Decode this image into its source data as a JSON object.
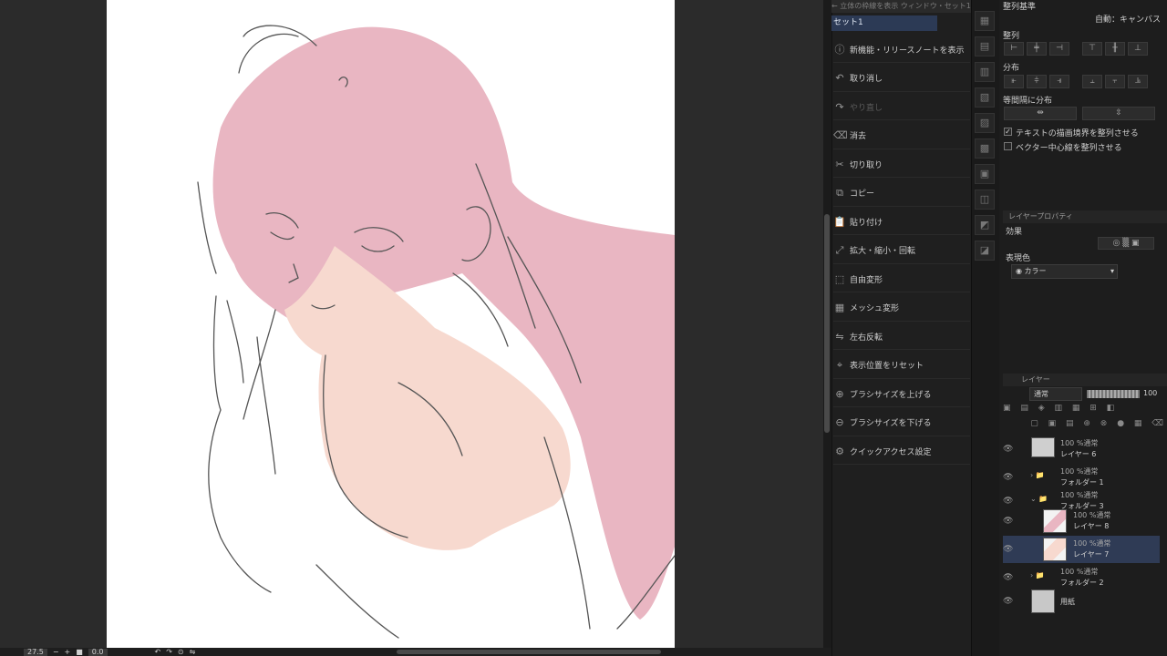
{
  "statusbar": {
    "zoom": "27.5",
    "angle": "0.0"
  },
  "quick_access": {
    "header_text": "← 立体の枠線を表示 ウィンドウ・セット1",
    "set_label": "セット1",
    "items": [
      {
        "label": "新機能・リリースノートを表示",
        "icon": "info-icon",
        "disabled": false
      },
      {
        "label": "取り消し",
        "icon": "undo-icon",
        "disabled": false
      },
      {
        "label": "やり直し",
        "icon": "redo-icon",
        "disabled": true
      },
      {
        "label": "消去",
        "icon": "clear-icon",
        "disabled": false
      },
      {
        "label": "切り取り",
        "icon": "scissors-icon",
        "disabled": false
      },
      {
        "label": "コピー",
        "icon": "copy-icon",
        "disabled": false
      },
      {
        "label": "貼り付け",
        "icon": "paste-icon",
        "disabled": false
      },
      {
        "label": "拡大・縮小・回転",
        "icon": "scale-icon",
        "disabled": false
      },
      {
        "label": "自由変形",
        "icon": "free-transform-icon",
        "disabled": false
      },
      {
        "label": "メッシュ変形",
        "icon": "mesh-icon",
        "disabled": false
      },
      {
        "label": "左右反転",
        "icon": "flip-icon",
        "disabled": false
      },
      {
        "label": "表示位置をリセット",
        "icon": "reset-view-icon",
        "disabled": false
      },
      {
        "label": "ブラシサイズを上げる",
        "icon": "brush-up-icon",
        "disabled": false
      },
      {
        "label": "ブラシサイズを下げる",
        "icon": "brush-down-icon",
        "disabled": false
      },
      {
        "label": "クイックアクセス設定",
        "icon": "settings-icon",
        "disabled": false
      }
    ]
  },
  "align_panel": {
    "title": "整列基準",
    "auto_label": "自動：キャンバス",
    "align_label": "整列",
    "distribute_label": "分布",
    "equal_spacing_label": "等間隔に分布",
    "check_text_bounds": {
      "label": "テキストの描画境界を整列させる",
      "checked": true
    },
    "check_vector_center": {
      "label": "ベクター中心線を整列させる",
      "checked": false
    }
  },
  "layer_property": {
    "tab_label": "レイヤープロパティ",
    "effect_label": "効果",
    "display_color_label": "表現色",
    "display_color_value": "カラー"
  },
  "layers_panel": {
    "tab_label": "レイヤー",
    "blend_mode": "通常",
    "opacity": "100",
    "layers": [
      {
        "name": "レイヤー 6",
        "mode": "100 %通常",
        "type": "layer"
      },
      {
        "name": "フォルダー 1",
        "mode": "100 %通常",
        "type": "folder"
      },
      {
        "name": "フォルダー 3",
        "mode": "100 %通常",
        "type": "folder-open"
      },
      {
        "name": "レイヤー 8",
        "mode": "100 %通常",
        "type": "layer"
      },
      {
        "name": "レイヤー 7",
        "mode": "100 %通常",
        "type": "layer-selected"
      },
      {
        "name": "フォルダー 2",
        "mode": "100 %通常",
        "type": "folder"
      },
      {
        "name": "用紙",
        "mode": "",
        "type": "paper"
      }
    ]
  },
  "colors": {
    "hair": "#e9b6c2",
    "skin": "#f7d9cf",
    "selection": "#2f3b55",
    "panel": "#1d1d1d"
  }
}
